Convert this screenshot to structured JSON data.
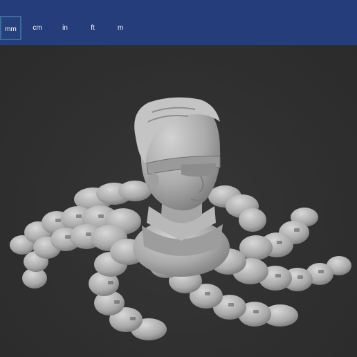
{
  "units": [
    {
      "label": "mm",
      "active": true
    },
    {
      "label": "cm",
      "active": false
    },
    {
      "label": "in",
      "active": false
    },
    {
      "label": "ft",
      "active": false
    },
    {
      "label": "m",
      "active": false
    }
  ],
  "colors": {
    "toolbar": "#263d7c",
    "viewport": "#2f2f2f",
    "model": "#b5b5b5"
  },
  "model": {
    "icon": "3d-model-figure"
  }
}
